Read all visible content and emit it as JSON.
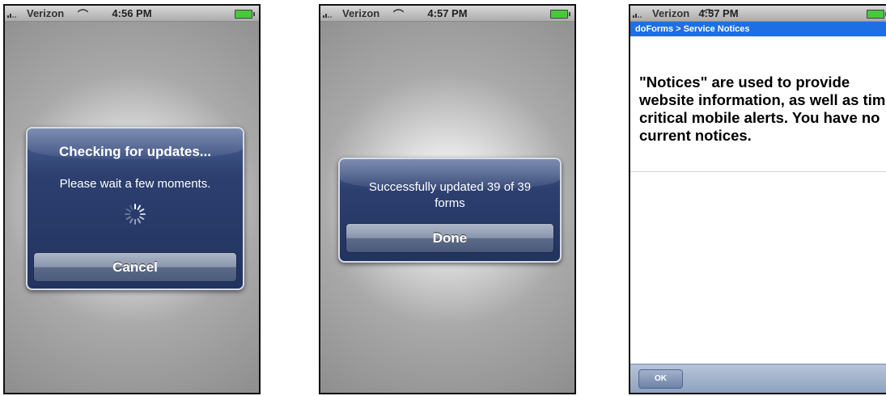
{
  "screens": [
    {
      "status": {
        "carrier": "Verizon",
        "time": "4:56 PM"
      },
      "alert": {
        "title": "Checking for updates...",
        "message": "Please wait a few moments.",
        "button": "Cancel"
      }
    },
    {
      "status": {
        "carrier": "Verizon",
        "time": "4:57 PM"
      },
      "alert": {
        "message": "Successfully updated 39 of 39 forms",
        "button": "Done"
      }
    },
    {
      "status": {
        "carrier": "Verizon",
        "time": "4:57 PM"
      },
      "breadcrumb": "doForms > Service Notices",
      "notice": "\"Notices\" are used to provide website information, as well as time critical mobile alerts.  You have no current notices.",
      "toolbar": {
        "ok_label": "OK"
      }
    }
  ],
  "colors": {
    "alert_bg": "#2c3f6f",
    "navbar_bg": "#1e6fe3",
    "battery": "#46c93a"
  },
  "icons": [
    "signal-icon",
    "wifi-icon",
    "battery-icon",
    "spinner-icon"
  ]
}
